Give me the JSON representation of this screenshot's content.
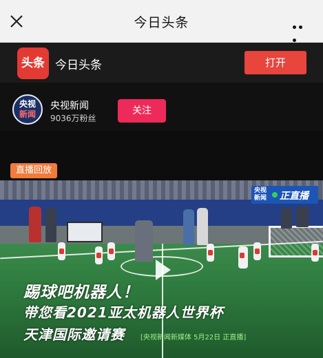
{
  "topbar": {
    "title": "今日头条",
    "close_icon": "close-icon",
    "more_icon": "more-icon"
  },
  "app": {
    "logo_text": "头条",
    "name": "今日头条",
    "open_label": "打开"
  },
  "account": {
    "avatar_line1": "央视",
    "avatar_line2": "新闻",
    "name": "央视新闻",
    "fans": "9036万粉丝",
    "follow_label": "关注"
  },
  "live_badge": "直播回放",
  "video": {
    "live_logo_line1": "央视",
    "live_logo_line2": "新闻",
    "live_logo_text": "正直播",
    "caption1": "踢球吧机器人！",
    "caption2": "带您看2021亚太机器人世界杯",
    "caption3": "天津国际邀请赛",
    "tagline": "[央视新闻新媒体  5月22日  正直播]",
    "play_icon": "play-icon"
  },
  "colors": {
    "accent_red": "#e8453d",
    "follow_pink": "#ee2a5a",
    "badge_orange": "#f07b3b"
  }
}
